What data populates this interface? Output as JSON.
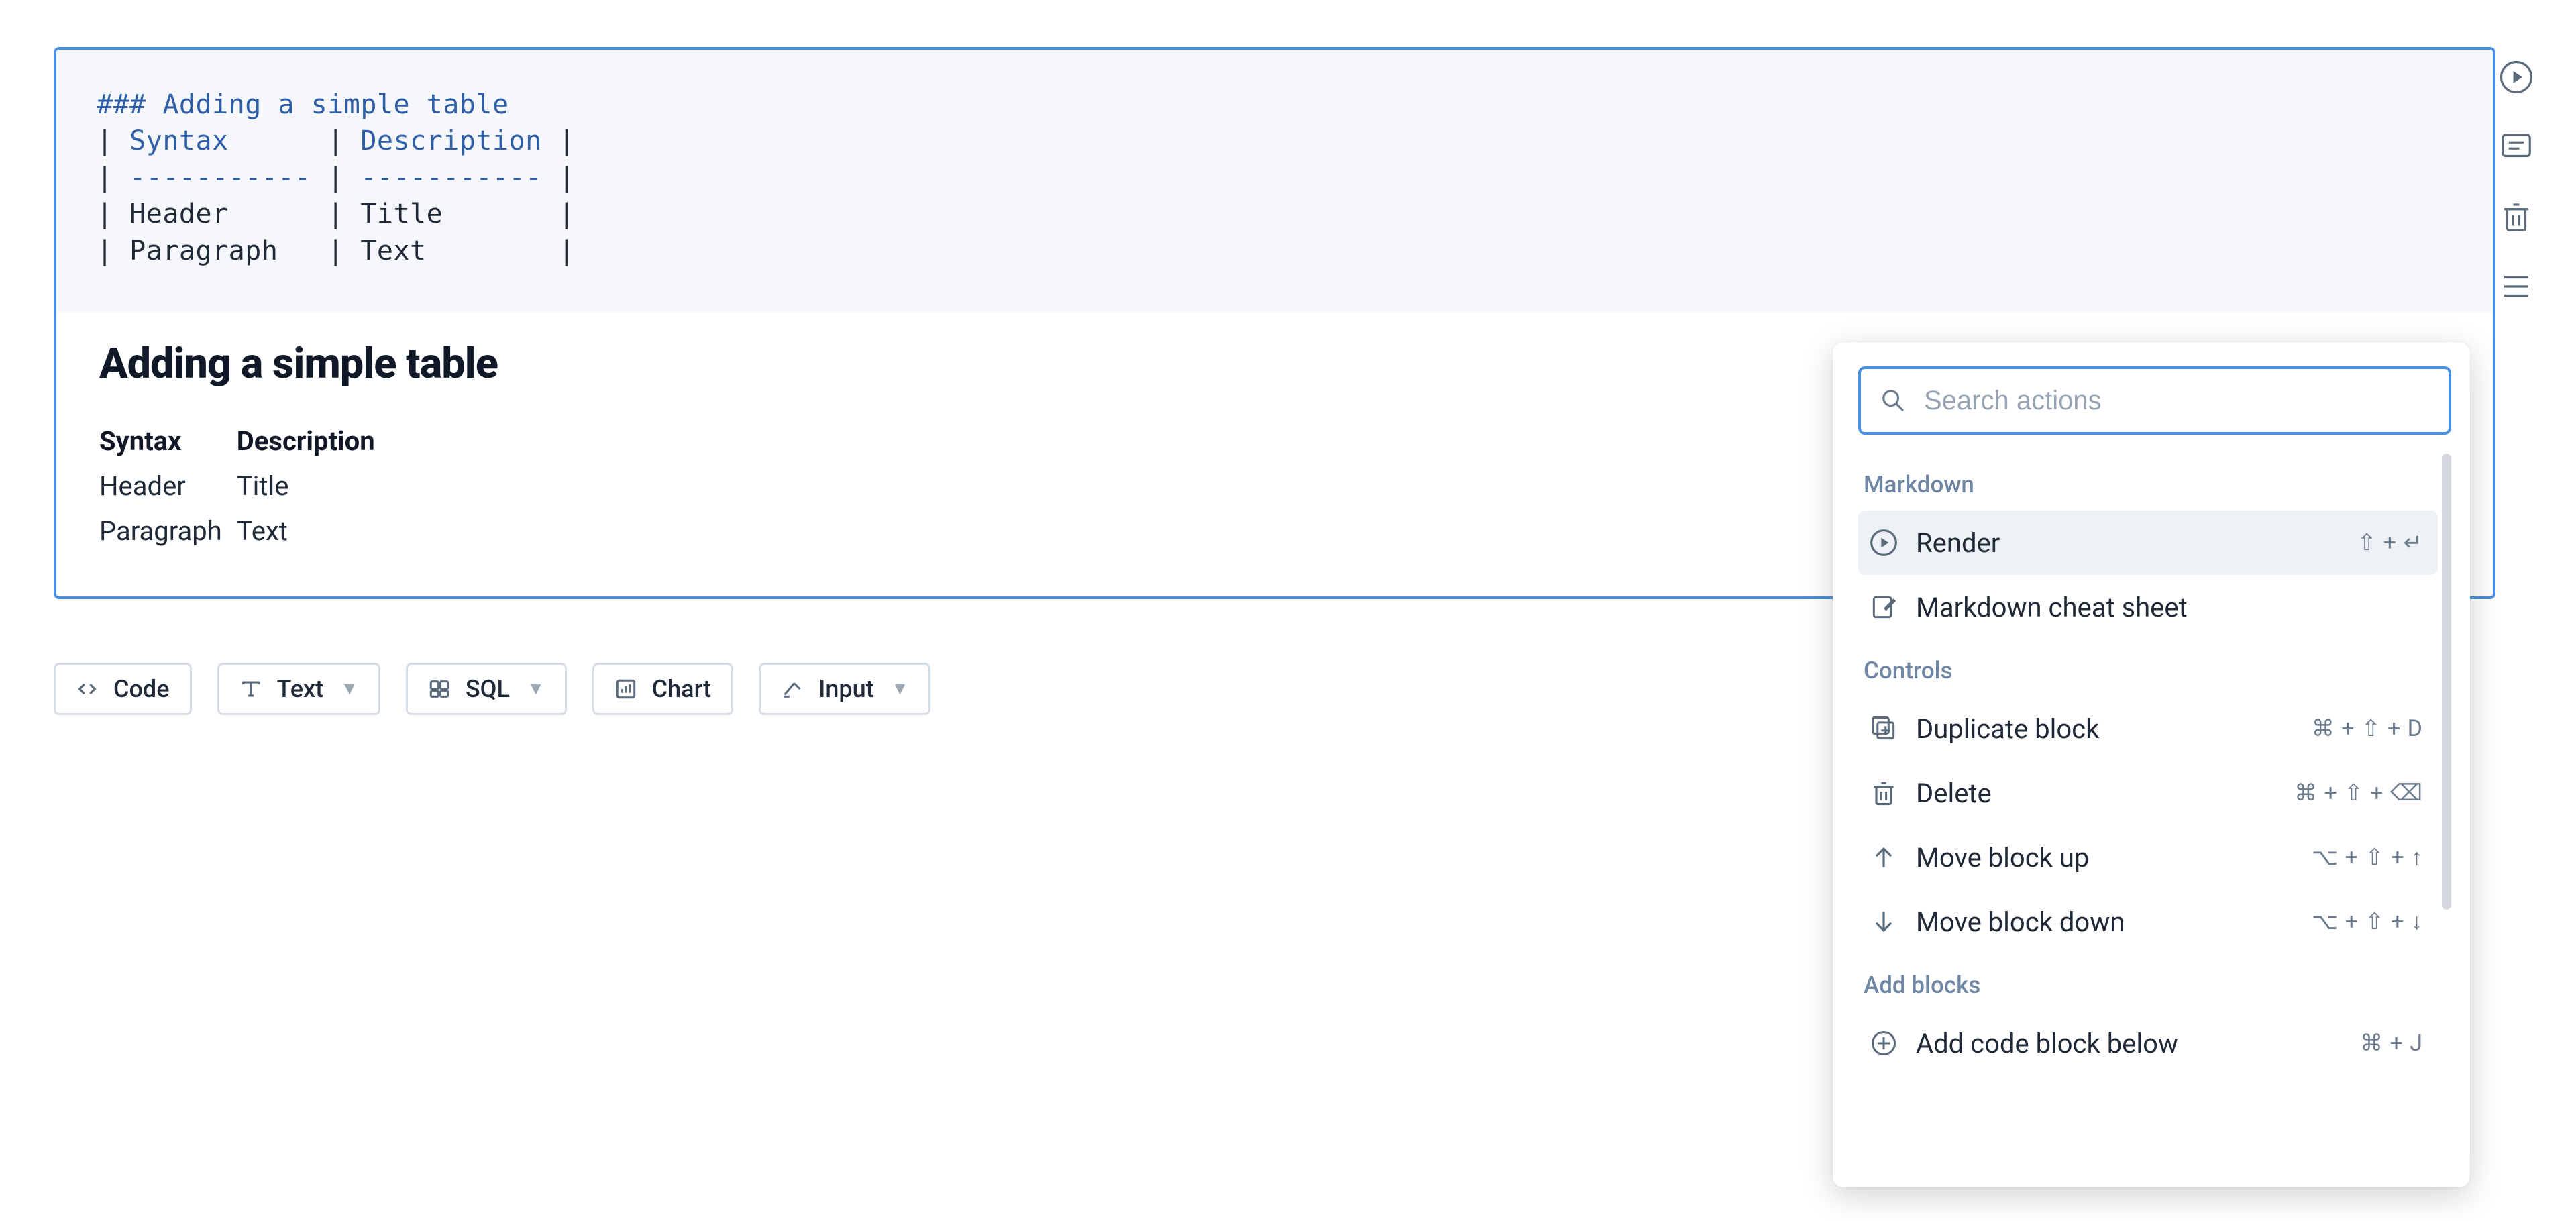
{
  "cell": {
    "source_lines": [
      {
        "kind": "h",
        "text": "### Adding a simple table"
      },
      {
        "kind": "thr",
        "text": "| Syntax      | Description |"
      },
      {
        "kind": "sep",
        "text": "| ----------- | ----------- |"
      },
      {
        "kind": "td",
        "text": "| Header      | Title       |"
      },
      {
        "kind": "td",
        "text": "| Paragraph   | Text        |"
      }
    ],
    "preview": {
      "heading": "Adding a simple table",
      "table": {
        "headers": [
          "Syntax",
          "Description"
        ],
        "rows": [
          [
            "Header",
            "Title"
          ],
          [
            "Paragraph",
            "Text"
          ]
        ]
      }
    }
  },
  "addbar": {
    "code": {
      "label": "Code"
    },
    "text": {
      "label": "Text",
      "hasMenu": true
    },
    "sql": {
      "label": "SQL",
      "hasMenu": true
    },
    "chart": {
      "label": "Chart"
    },
    "input": {
      "label": "Input",
      "hasMenu": true
    }
  },
  "rail": {
    "run": "run-icon",
    "comment": "comment-icon",
    "delete": "trash-icon",
    "menu": "menu-icon"
  },
  "popover": {
    "search_placeholder": "Search actions",
    "groups": [
      {
        "label": "Markdown",
        "items": [
          {
            "id": "render",
            "icon": "play",
            "label": "Render",
            "shortcut": "⇧ + ↵",
            "hi": true
          },
          {
            "id": "cheatsheet",
            "icon": "doc-edit",
            "label": "Markdown cheat sheet",
            "shortcut": ""
          }
        ]
      },
      {
        "label": "Controls",
        "items": [
          {
            "id": "duplicate",
            "icon": "duplicate",
            "label": "Duplicate block",
            "shortcut": "⌘ + ⇧ + D"
          },
          {
            "id": "delete",
            "icon": "trash",
            "label": "Delete",
            "shortcut": "⌘ + ⇧ + ⌫"
          },
          {
            "id": "moveup",
            "icon": "arrow-up",
            "label": "Move block up",
            "shortcut": "⌥ + ⇧ + ↑"
          },
          {
            "id": "movedown",
            "icon": "arrow-down",
            "label": "Move block down",
            "shortcut": "⌥ + ⇧ + ↓"
          }
        ]
      },
      {
        "label": "Add blocks",
        "items": [
          {
            "id": "addcode",
            "icon": "plus-circle",
            "label": "Add code block below",
            "shortcut": "⌘ + J",
            "cut": true
          }
        ]
      }
    ]
  }
}
